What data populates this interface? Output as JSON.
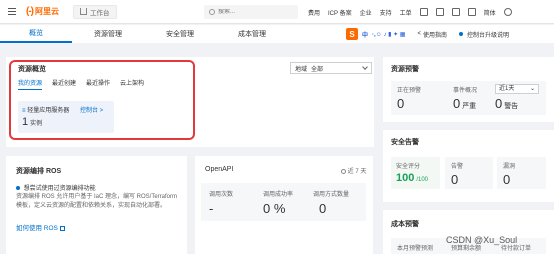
{
  "topbar": {
    "logo_mark": "(-)",
    "logo_text": "阿里云",
    "workbench": "工作台",
    "search_placeholder": "搜索...",
    "nav": [
      "费用",
      "ICP 备案",
      "企业",
      "支持",
      "工单"
    ],
    "lang": "简体"
  },
  "subheader": {
    "tabs": [
      "概览",
      "资源管理",
      "安全管理",
      "成本管理"
    ],
    "ime_label": "中",
    "guide": "使用指南",
    "control": "控制台升级说明"
  },
  "overview": {
    "title": "资源概览",
    "region_label": "地域",
    "region_value": "全部",
    "tabs": [
      "我的资源",
      "最近创建",
      "最近操作",
      "云上架构"
    ],
    "resource_name": "轻量应用服务器",
    "resource_link": "控制台 >",
    "resource_count": "1",
    "resource_unit": "实例"
  },
  "ros": {
    "title": "资源编排 ROS",
    "subtitle": "想尝试使用过资源编排功能",
    "desc": "资源编排 ROS 允许用户基于 IaC 理念，编写 ROS/Terraform 模板，定义云资源的配置和依赖关系，实现自动化部署。",
    "link": "如何使用 ROS"
  },
  "openapi": {
    "title": "OpenAPI",
    "period": "近 7 天",
    "cols": [
      "调用次数",
      "调用成功率",
      "调用方式数量"
    ],
    "values": [
      "-",
      "0 %",
      "0"
    ]
  },
  "alert": {
    "title": "资源预警",
    "col1_label": "正在预警",
    "col1_value": "0",
    "col2_label": "事件概况",
    "col2_value": "0",
    "col2_unit": "严重",
    "col3_select": "近1天",
    "col3_value": "0",
    "col3_unit": "警告"
  },
  "security": {
    "title": "安全告警",
    "score_label": "安全评分",
    "score_value": "100",
    "score_unit": "/100",
    "alarm_label": "告警",
    "alarm_value": "0",
    "vuln_label": "漏洞",
    "vuln_value": "0"
  },
  "cost": {
    "title": "成本预警",
    "cols": [
      "本月预警预测",
      "预算剩余额",
      "待付款订单"
    ]
  },
  "watermark": "CSDN @Xu_Soul",
  "colors": {
    "accent": "#0070cc",
    "brand": "#ff6a00",
    "highlight": "#e4393c",
    "green": "#18a058"
  }
}
